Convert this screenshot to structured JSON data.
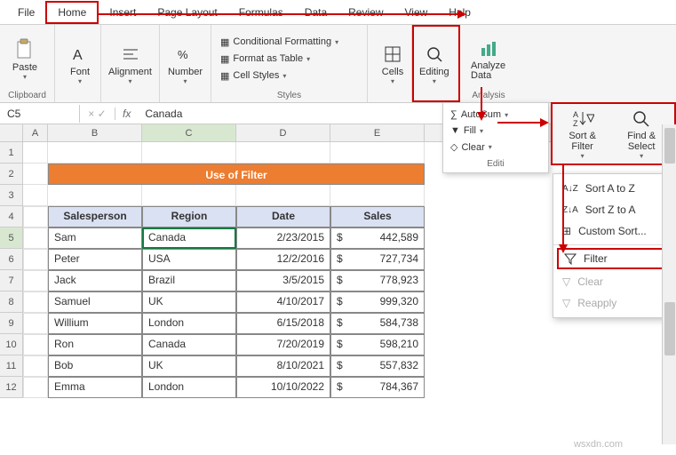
{
  "tabs": [
    "File",
    "Home",
    "Insert",
    "Page Layout",
    "Formulas",
    "Data",
    "Review",
    "View",
    "Help"
  ],
  "active_tab": "Home",
  "ribbon": {
    "clipboard": {
      "paste": "Paste",
      "label": "Clipboard"
    },
    "font": {
      "btn": "Font"
    },
    "alignment": {
      "btn": "Alignment"
    },
    "number": {
      "btn": "Number"
    },
    "styles": {
      "cond_fmt": "Conditional Formatting",
      "fmt_table": "Format as Table",
      "cell_styles": "Cell Styles",
      "label": "Styles"
    },
    "cells": {
      "btn": "Cells"
    },
    "editing": {
      "btn": "Editing"
    },
    "analysis": {
      "btn": "Analyze Data",
      "label": "Analysis"
    }
  },
  "edit_panel": {
    "autosum": "AutoSum",
    "fill": "Fill",
    "clear": "Clear",
    "label": "Editi"
  },
  "sort_filter_btn": "Sort & Filter",
  "find_select_btn": "Find & Select",
  "sort_menu": {
    "az": "Sort A to Z",
    "za": "Sort Z to A",
    "custom": "Custom Sort...",
    "filter": "Filter",
    "clear": "Clear",
    "reapply": "Reapply"
  },
  "namebox": "C5",
  "formula_value": "Canada",
  "columns": [
    "A",
    "B",
    "C",
    "D",
    "E"
  ],
  "title_banner": "Use of Filter",
  "table": {
    "headers": [
      "Salesperson",
      "Region",
      "Date",
      "Sales"
    ],
    "rows": [
      {
        "sp": "Sam",
        "region": "Canada",
        "date": "2/23/2015",
        "sym": "$",
        "sales": "442,589"
      },
      {
        "sp": "Peter",
        "region": "USA",
        "date": "12/2/2016",
        "sym": "$",
        "sales": "727,734"
      },
      {
        "sp": "Jack",
        "region": "Brazil",
        "date": "3/5/2015",
        "sym": "$",
        "sales": "778,923"
      },
      {
        "sp": "Samuel",
        "region": "UK",
        "date": "4/10/2017",
        "sym": "$",
        "sales": "999,320"
      },
      {
        "sp": "Willium",
        "region": "London",
        "date": "6/15/2018",
        "sym": "$",
        "sales": "584,738"
      },
      {
        "sp": "Ron",
        "region": "Canada",
        "date": "7/20/2019",
        "sym": "$",
        "sales": "598,210"
      },
      {
        "sp": "Bob",
        "region": "UK",
        "date": "8/10/2021",
        "sym": "$",
        "sales": "557,832"
      },
      {
        "sp": "Emma",
        "region": "London",
        "date": "10/10/2022",
        "sym": "$",
        "sales": "784,367"
      }
    ]
  },
  "watermark": "wsxdn.com"
}
